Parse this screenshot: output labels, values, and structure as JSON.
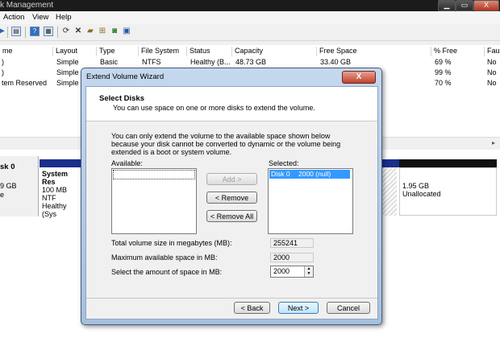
{
  "window": {
    "title": "k Management",
    "buttons": {
      "minimize": "▁",
      "maximize": "▭",
      "close": "X"
    }
  },
  "menu": {
    "items": [
      "Action",
      "View",
      "Help"
    ]
  },
  "toolbar": {
    "icons": [
      "back-icon",
      "forward-icon",
      "disk-list-icon",
      "help-icon",
      "properties-icon",
      "refresh-icon",
      "delete-icon",
      "open-icon",
      "explore-icon",
      "find-icon",
      "settings-icon"
    ]
  },
  "volume_list": {
    "columns": [
      "me",
      "Layout",
      "Type",
      "File System",
      "Status",
      "Capacity",
      "Free Space",
      "% Free",
      "Fau"
    ],
    "rows": [
      {
        "volume": ")",
        "layout": "Simple",
        "type": "Basic",
        "fs": "NTFS",
        "status": "Healthy (B...",
        "capacity": "48.73 GB",
        "free": "33.40 GB",
        "pct": "69 %",
        "fault": "No"
      },
      {
        "volume": ")",
        "layout": "Simple",
        "pct": "99 %",
        "fault": "No"
      },
      {
        "volume": "tem Reserved",
        "layout": "Simple",
        "pct": "70 %",
        "fault": "No"
      }
    ]
  },
  "disk_map": {
    "disk_label": "sk 0",
    "disk_size": "9 GB",
    "disk_state": "e",
    "system_part": {
      "name": "System Res",
      "size": "100 MB NTF",
      "status": "Healthy (Sys"
    },
    "unallocated": {
      "size": "1.95 GB",
      "label": "Unallocated"
    }
  },
  "dialog": {
    "title": "Extend Volume Wizard",
    "close": "X",
    "header_title": "Select Disks",
    "header_subtitle": "You can use space on one or more disks to extend the volume.",
    "note": "You can only extend the volume to the available space shown below because your disk cannot be converted to dynamic or the volume being extended is a boot or system volume.",
    "available_label": "Available:",
    "selected_label": "Selected:",
    "selected_items": [
      {
        "disk": "Disk 0",
        "size": "2000 (null)"
      }
    ],
    "add_label": "Add >",
    "remove_label": "< Remove",
    "remove_all_label": "< Remove All",
    "total_label": "Total volume size in megabytes (MB):",
    "total_value": "255241",
    "max_label": "Maximum available space in MB:",
    "max_value": "2000",
    "select_label": "Select the amount of space in MB:",
    "select_value": "2000",
    "back_label": "< Back",
    "next_label": "Next >",
    "cancel_label": "Cancel"
  }
}
